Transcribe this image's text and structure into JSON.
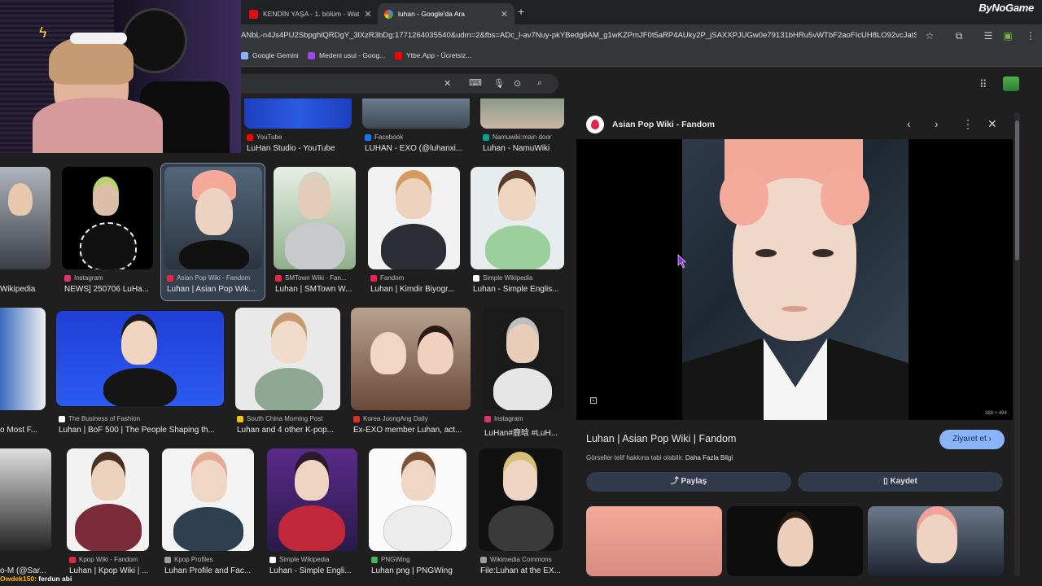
{
  "tabs": [
    {
      "label": "KENDİN YAŞA - 1. bölüm - Wat",
      "color": "#e50914"
    },
    {
      "label": "luhan - Google'da Ara",
      "color": "#4285f4"
    }
  ],
  "brand": "ByNoGame",
  "url": "ANbL-n4Js4PU2SbpghlQRDgY_3lXzR3bDg:1771264035540&udm=2&fbs=ADc_l-av7Nuy-pkYBedg6AM_g1wKZPmJF0t5aRP4AUky2P_jSAXXPJUGw0e79131bHRu5vWTbF2aoFIcUH8LO92vcJatSG...",
  "bookmarks": [
    {
      "label": "Google Gemini",
      "color": "#8ab4f8"
    },
    {
      "label": "Medeni usul - Goog...",
      "color": "#a142f4"
    },
    {
      "label": "Ytbe.App - Ücretsiz...",
      "color": "#ff0000"
    }
  ],
  "results_top": [
    {
      "source": "YouTube",
      "caption": "LuHan Studio - YouTube",
      "icon": "#ff0000"
    },
    {
      "source": "Facebook",
      "caption": "LUHAN - EXO (@luhanxi...",
      "icon": "#1877f2"
    },
    {
      "source": "Namuwiki:main door",
      "caption": "Luhan - NamuWiki",
      "icon": "#00a495"
    }
  ],
  "results_row1": [
    {
      "source": "",
      "caption": "Wikipedia",
      "icon": "#ffffff"
    },
    {
      "source": "Instagram",
      "caption": "NEWS] 250706 LuHa...",
      "icon": "#e1306c"
    },
    {
      "source": "Asian Pop Wiki - Fandom",
      "caption": "Luhan | Asian Pop Wik...",
      "icon": "#e5264a"
    },
    {
      "source": "SMTown Wiki - Fan...",
      "caption": "Luhan | SMTown W...",
      "icon": "#e5264a"
    },
    {
      "source": "Fandom",
      "caption": "Luhan | Kimdir Biyogr...",
      "icon": "#e5264a"
    },
    {
      "source": "Simple Wikipedia",
      "caption": "Luhan - Simple Englis...",
      "icon": "#ffffff"
    }
  ],
  "results_row2": [
    {
      "source": "",
      "caption": "o Most F...",
      "icon": "#ffffff"
    },
    {
      "source": "The Business of Fashion",
      "caption": "Luhan | BoF 500 | The People Shaping th...",
      "icon": "#ffffff"
    },
    {
      "source": "South China Morning Post",
      "caption": "Luhan and 4 other K-pop...",
      "icon": "#f5c400"
    },
    {
      "source": "Korea JoongAng Daily",
      "caption": "Ex-EXO member Luhan, act...",
      "icon": "#d93025"
    },
    {
      "source": "Instagram",
      "caption": "LuHan#鹿晗 #LuH...",
      "icon": "#e1306c"
    }
  ],
  "results_row3": [
    {
      "source": "",
      "caption": "o-M (@Sar...",
      "icon": "#ffffff"
    },
    {
      "source": "Kpop Wiki - Fandom",
      "caption": "Luhan | Kpop Wiki | ...",
      "icon": "#e5264a"
    },
    {
      "source": "Kpop Profiles",
      "caption": "Luhan Profile and Fac...",
      "icon": "#9aa0a6"
    },
    {
      "source": "Simple Wikipedia",
      "caption": "Luhan - Simple Engli...",
      "icon": "#ffffff"
    },
    {
      "source": "PNGWing",
      "caption": "Luhan png | PNGWing",
      "icon": "#4caf50"
    },
    {
      "source": "Wikimedia Commons",
      "caption": "File:Luhan at the EX...",
      "icon": "#9aa0a6"
    }
  ],
  "panel": {
    "site": "Asian Pop Wiki - Fandom",
    "dimensions": "388 × 494",
    "title": "Luhan | Asian Pop Wiki | Fandom",
    "visit": "Ziyaret et",
    "copyright": "Görseller telif hakkına tabi olabilir.",
    "learn_more": "Daha Fazla Bilgi",
    "share": "Paylaş",
    "save": "Kaydet"
  },
  "chat": {
    "user": "Owdek150",
    "message": ": ferdun abi"
  }
}
